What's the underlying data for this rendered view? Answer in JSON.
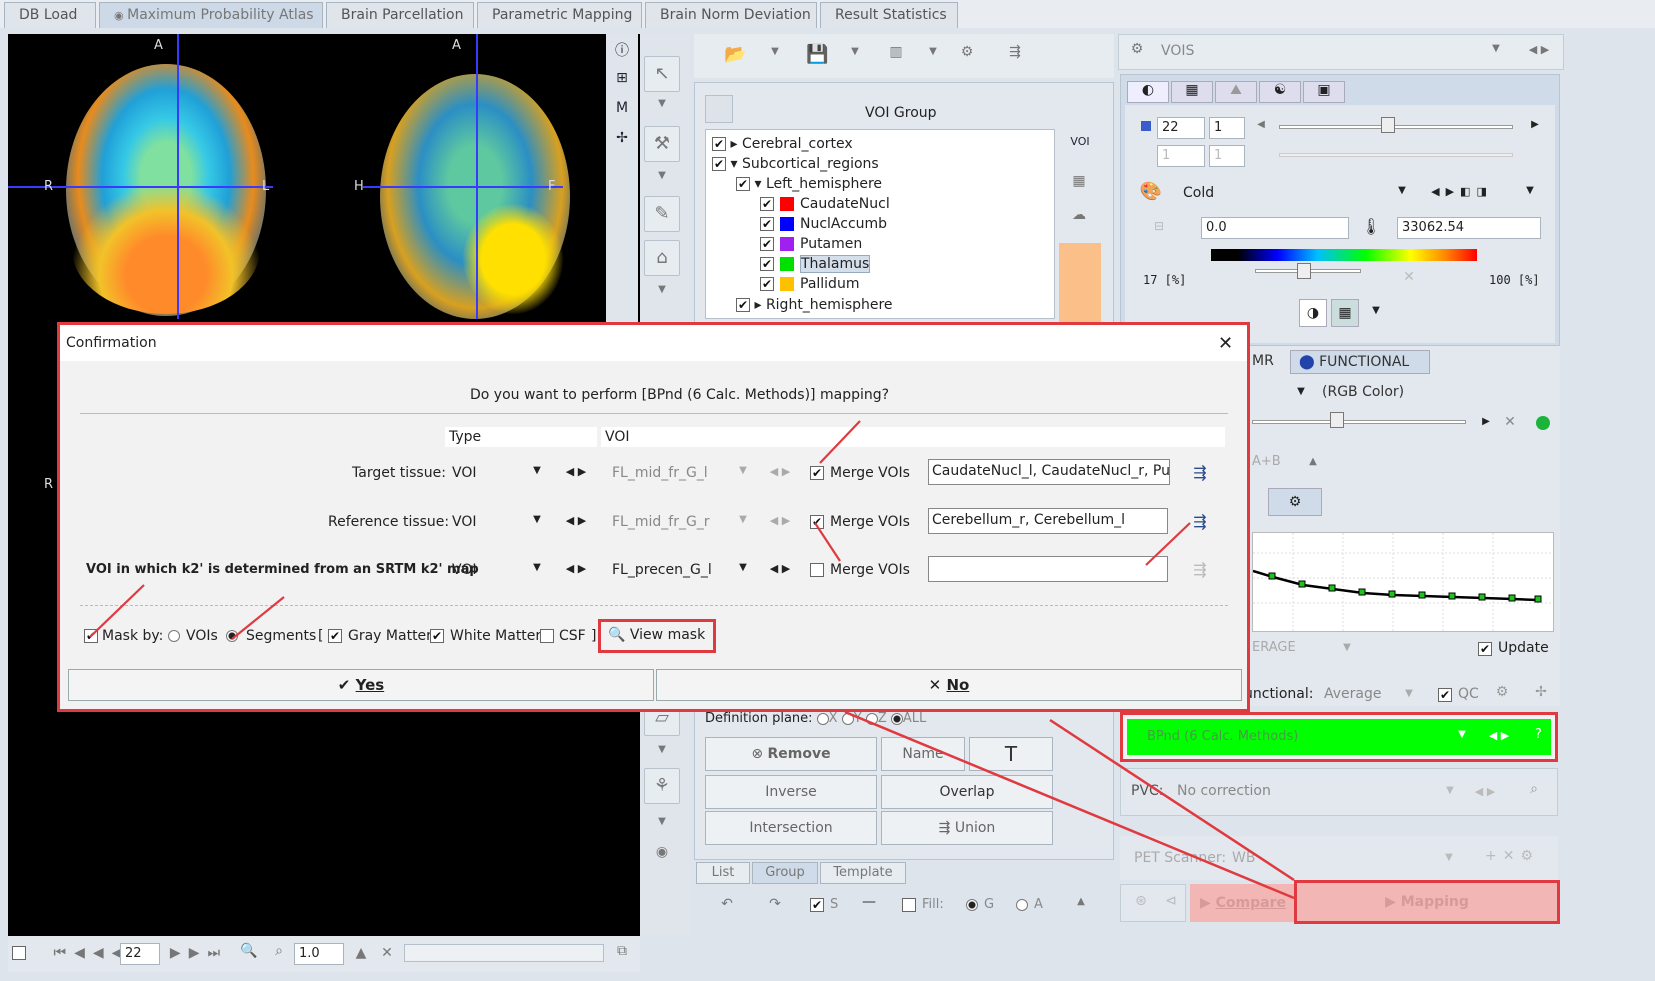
{
  "tabs": [
    "DB Load",
    "Maximum Probability Atlas",
    "Brain Parcellation",
    "Parametric Mapping",
    "Brain Norm Deviation",
    "Result Statistics"
  ],
  "viewer": {
    "orient_labels": {
      "a1": "A",
      "a2": "A",
      "r": "R",
      "l": "L",
      "h": "H",
      "f": "F",
      "r2": "R"
    },
    "slice": "22",
    "zoom": "1.0"
  },
  "voi_group": {
    "title": "VOI Group",
    "tree": [
      {
        "label": "Cerebral_cortex",
        "checked": true
      },
      {
        "label": "Subcortical_regions",
        "checked": true
      },
      {
        "label": "Left_hemisphere",
        "checked": true
      },
      {
        "label": "CaudateNucl",
        "color": "#ff0000"
      },
      {
        "label": "NuclAccumb",
        "color": "#0000ff"
      },
      {
        "label": "Putamen",
        "color": "#a020f0"
      },
      {
        "label": "Thalamus",
        "color": "#00e000"
      },
      {
        "label": "Pallidum",
        "color": "#ffc000"
      },
      {
        "label": "Right_hemisphere",
        "checked": true
      }
    ],
    "definition_plane": "Definition plane:",
    "plane_opts": [
      "X",
      "Y",
      "Z",
      "ALL"
    ],
    "buttons": {
      "remove": "Remove",
      "name": "Name",
      "inverse": "Inverse",
      "overlap": "Overlap",
      "intersection": "Intersection",
      "union": "Union"
    },
    "bottom_tabs": [
      "List",
      "Group",
      "Template"
    ],
    "bottom_s": "S",
    "fill_label": "Fill:",
    "fill_g": "G",
    "fill_a": "A"
  },
  "right": {
    "vois_select": "VOIS",
    "slice_a": "22",
    "slice_b": "1",
    "slice_c": "1",
    "slice_d": "1",
    "colormap": "Cold",
    "min_val": "0.0",
    "max_val": "33062.54",
    "pct_low": "17 [%]",
    "pct_high": "100 [%]",
    "tab_mr": "MR",
    "tab_functional": "FUNCTIONAL",
    "rgb_color": "(RGB Color)",
    "apb": "A+B",
    "average_label": "ERAGE",
    "update": "Update",
    "functional_label": "unctional:",
    "functional_value": "Average",
    "qc": "QC",
    "method_select": "BPnd (6 Calc. Methods)",
    "method_q": "?",
    "pvc_label": "PVC:",
    "pvc_value": "No correction",
    "pet_label": "PET Scanner:",
    "pet_value": "WB",
    "compare": "Compare",
    "mapping": "Mapping"
  },
  "dialog": {
    "title": "Confirmation",
    "question": "Do you want to perform [BPnd (6 Calc. Methods)] mapping?",
    "col_type": "Type",
    "col_voi": "VOI",
    "rows": [
      {
        "label": "Target tissue:",
        "type": "VOI",
        "voi": "FL_mid_fr_G_l",
        "merge": "Merge VOIs",
        "merged": true,
        "value": "CaudateNucl_l, CaudateNucl_r, Putamen_l"
      },
      {
        "label": "Reference tissue:",
        "type": "VOI",
        "voi": "FL_mid_fr_G_r",
        "merge": "Merge VOIs",
        "merged": true,
        "value": "Cerebellum_r, Cerebellum_l"
      },
      {
        "label": "VOI in which k2' is determined from an SRTM k2' map",
        "type": "VOI",
        "voi": "FL_precen_G_l",
        "merge": "Merge VOIs",
        "merged": false,
        "value": ""
      }
    ],
    "mask_by": "Mask by:",
    "vois": "VOIs",
    "segments": "Segments",
    "bracket_open": "[",
    "bracket_close": "]",
    "gray_matter": "Gray Matter",
    "white_matter": "White Matter",
    "csf": "CSF",
    "view_mask": "View mask",
    "yes": "Yes",
    "no": "No",
    "close": "✕"
  },
  "colors": {
    "accent_red": "#e0393f",
    "method_green": "#00ff00",
    "mapping_pink": "#f2b7b4"
  }
}
